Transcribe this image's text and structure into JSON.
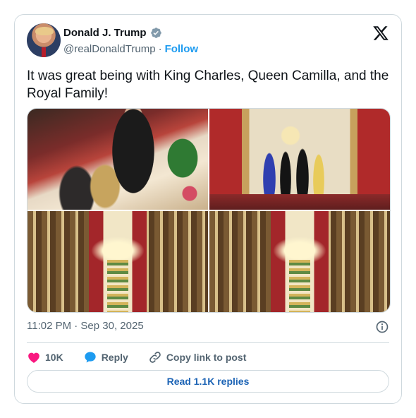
{
  "author": {
    "name": "Donald J. Trump",
    "handle": "@realDonaldTrump",
    "separator": "·",
    "follow_label": "Follow",
    "verified_color": "#829aab"
  },
  "tweet": {
    "text": "It was great being with King Charles, Queen Camilla, and the Royal Family!",
    "timestamp": "11:02 PM · Sep 30, 2025",
    "media": [
      {
        "name": "banquet-speech-photo"
      },
      {
        "name": "state-room-photo"
      },
      {
        "name": "st-georges-hall-photo-1"
      },
      {
        "name": "st-georges-hall-photo-2"
      }
    ]
  },
  "actions": {
    "like_count": "10K",
    "reply_label": "Reply",
    "copy_label": "Copy link to post",
    "read_replies_label": "Read 1.1K replies"
  },
  "colors": {
    "accent": "#1d9bf0",
    "link": "#1d64b5",
    "like": "#f91880",
    "secondary_text": "#536471",
    "border": "#cfd9de"
  },
  "icons": {
    "brand": "x-logo-icon",
    "verified": "verified-badge-icon",
    "info": "info-icon",
    "like": "heart-icon",
    "reply": "speech-bubble-icon",
    "copy": "link-icon"
  }
}
